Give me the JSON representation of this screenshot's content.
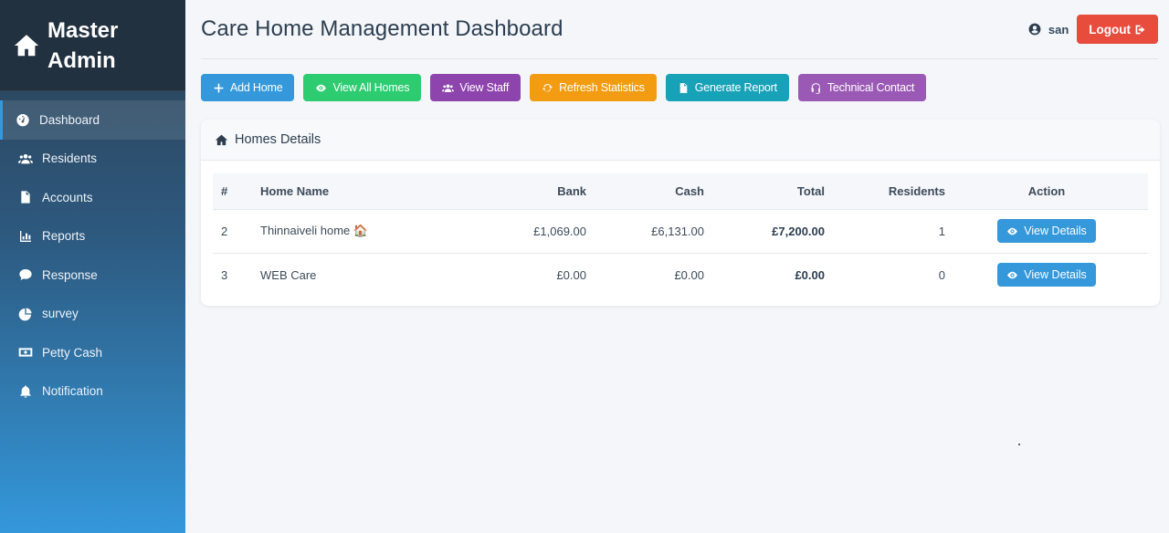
{
  "sidebar": {
    "brand_line1": "Master",
    "brand_line2": "Admin",
    "items": [
      {
        "label": "Dashboard",
        "icon": "tachometer-icon",
        "active": true
      },
      {
        "label": "Residents",
        "icon": "users-icon",
        "active": false
      },
      {
        "label": "Accounts",
        "icon": "file-invoice-icon",
        "active": false
      },
      {
        "label": "Reports",
        "icon": "chart-bar-icon",
        "active": false
      },
      {
        "label": "Response",
        "icon": "comment-icon",
        "active": false
      },
      {
        "label": "survey",
        "icon": "chart-pie-icon",
        "active": false
      },
      {
        "label": "Petty Cash",
        "icon": "money-bill-icon",
        "active": false
      },
      {
        "label": "Notification",
        "icon": "bell-icon",
        "active": false
      }
    ]
  },
  "header": {
    "title": "Care Home Management Dashboard",
    "username": "san",
    "logout_label": "Logout"
  },
  "actions": [
    {
      "label": "Add Home",
      "icon": "plus-icon",
      "color": "#3498db"
    },
    {
      "label": "View All Homes",
      "icon": "eye-icon",
      "color": "#2ecc71"
    },
    {
      "label": "View Staff",
      "icon": "users-icon",
      "color": "#8e44ad"
    },
    {
      "label": "Refresh Statistics",
      "icon": "sync-icon",
      "color": "#f39c12"
    },
    {
      "label": "Generate Report",
      "icon": "file-icon",
      "color": "#17a2b8"
    },
    {
      "label": "Technical Contact",
      "icon": "headset-icon",
      "color": "#9b59b6"
    }
  ],
  "homes": {
    "title": "Homes Details",
    "columns": [
      "#",
      "Home Name",
      "Bank",
      "Cash",
      "Total",
      "Residents",
      "Action"
    ],
    "rows": [
      {
        "num": "2",
        "name": "Thinnaiveli home 🏠",
        "bank": "£1,069.00",
        "cash": "£6,131.00",
        "total": "£7,200.00",
        "residents": "1",
        "action": "View Details"
      },
      {
        "num": "3",
        "name": "WEB Care",
        "bank": "£0.00",
        "cash": "£0.00",
        "total": "£0.00",
        "residents": "0",
        "action": "View Details"
      }
    ]
  }
}
